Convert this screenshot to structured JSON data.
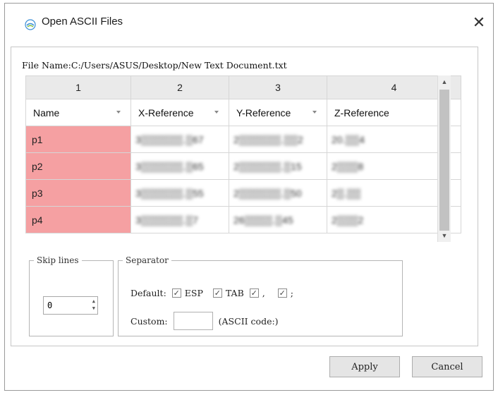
{
  "window": {
    "title": "Open ASCII Files",
    "close_glyph": "✕"
  },
  "file_name_label": "File Name:C:/Users/ASUS/Desktop/New Text Document.txt",
  "grid": {
    "column_numbers": [
      "1",
      "2",
      "3",
      "4"
    ],
    "headers": [
      "Name",
      "X-Reference",
      "Y-Reference",
      "Z-Reference"
    ],
    "rows": [
      {
        "name": "p1",
        "x": "3▒▒▒▒▒▒.▒67",
        "y": "2▒▒▒▒▒▒.▒▒2",
        "z": "20.▒▒4"
      },
      {
        "name": "p2",
        "x": "3▒▒▒▒▒▒.▒65",
        "y": "2▒▒▒▒▒▒.▒15",
        "z": "2▒▒▒8"
      },
      {
        "name": "p3",
        "x": "3▒▒▒▒▒▒.▒55",
        "y": "2▒▒▒▒▒▒.▒50",
        "z": "2▒.▒▒"
      },
      {
        "name": "p4",
        "x": "3▒▒▒▒▒▒.▒7",
        "y": "26▒▒▒▒.▒45",
        "z": "2▒▒▒2"
      }
    ],
    "name_cell_color": "#f5a0a2"
  },
  "skip_lines": {
    "legend": "Skip lines",
    "value": "0"
  },
  "separator": {
    "legend": "Separator",
    "default_label": "Default:",
    "options": [
      {
        "label": "ESP",
        "checked": true
      },
      {
        "label": "TAB",
        "checked": true
      },
      {
        "label": ",",
        "checked": true
      },
      {
        "label": ";",
        "checked": true
      }
    ],
    "custom_label": "Custom:",
    "custom_value": "",
    "ascii_hint": "(ASCII code:)"
  },
  "buttons": {
    "apply": "Apply",
    "cancel": "Cancel"
  }
}
